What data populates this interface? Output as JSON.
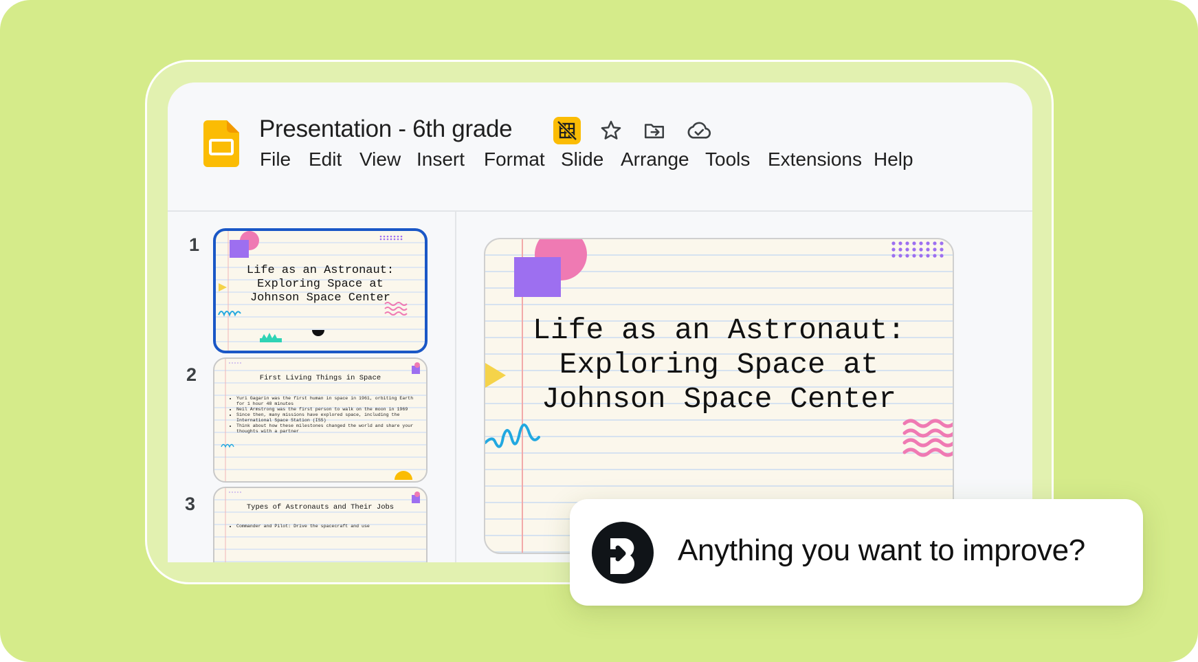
{
  "app": {
    "doc_title": "Presentation - 6th grade",
    "menu": [
      "File",
      "Edit",
      "View",
      "Insert",
      "Format",
      "Slide",
      "Arrange",
      "Tools",
      "Extensions",
      "Help"
    ],
    "title_icons": [
      "grid-off-badge-icon",
      "star-icon",
      "move-to-folder-icon",
      "cloud-saved-icon"
    ]
  },
  "filmstrip": {
    "slides": [
      {
        "number": "1",
        "title": "Life as an Astronaut: Exploring Space at Johnson Space Center",
        "selected": true
      },
      {
        "number": "2",
        "title": "First Living Things in Space",
        "bullets": [
          "Yuri Gagarin was the first human in space in 1961, orbiting Earth for 1 hour 48 minutes",
          "Neil Armstrong was the first person to walk on the moon in 1969",
          "Since then, many missions have explored space, including the International Space Station (ISS)",
          "Think about how these milestones changed the world and share your thoughts with a partner"
        ]
      },
      {
        "number": "3",
        "title": "Types of Astronauts and Their Jobs",
        "bullets": [
          "Commander and Pilot: Drive the spacecraft and use"
        ]
      }
    ]
  },
  "main_slide": {
    "title": "Life as an Astronaut:\nExploring Space at\nJohnson Space Center"
  },
  "toast": {
    "message": "Anything you want to improve?"
  },
  "colors": {
    "background": "#d5eb8a",
    "selected_border": "#1a57c6",
    "slides_yellow": "#fbbc04",
    "purple": "#9d6ff0",
    "pink": "#ef7ab3",
    "teal": "#2fd3b5",
    "cyan": "#22a8e0"
  }
}
